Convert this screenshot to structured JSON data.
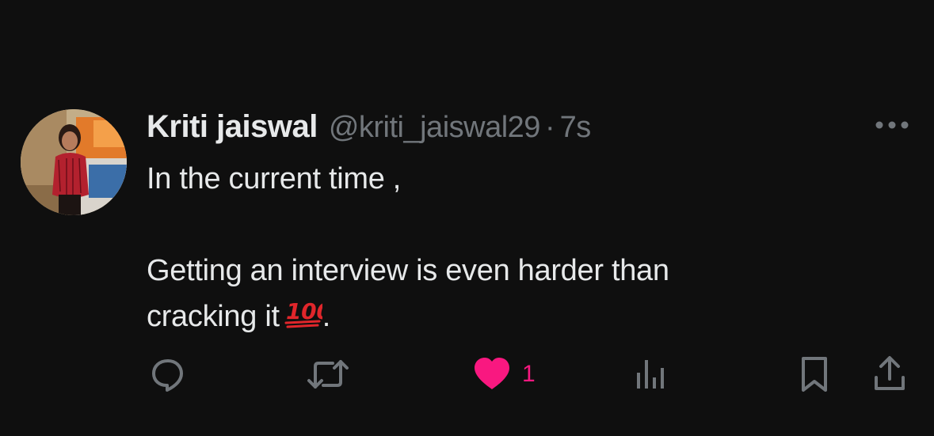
{
  "tweet": {
    "display_name": "Kriti jaiswal",
    "handle": "@kriti_jaiswal29",
    "separator": "·",
    "time": "7s",
    "lines": [
      "In the current time ,",
      "Getting an interview is even harder than",
      "cracking it"
    ],
    "trailing_punct": ".",
    "emoji": "hundred-points-emoji",
    "likes": "1",
    "liked": true
  },
  "colors": {
    "background": "#0f0f0f",
    "text": "#e7e9ea",
    "muted": "#71767b",
    "like": "#f91880",
    "emoji": "#e0262b"
  },
  "icons": {
    "more": "more-horizontal-icon",
    "reply": "reply-icon",
    "retweet": "retweet-icon",
    "like": "heart-icon",
    "views": "views-icon",
    "bookmark": "bookmark-icon",
    "share": "share-icon"
  }
}
